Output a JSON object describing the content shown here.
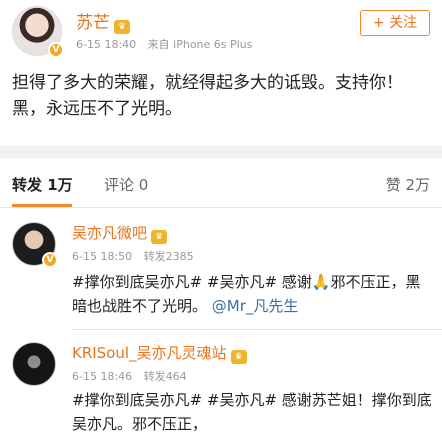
{
  "post": {
    "author": "苏芒",
    "date": "6-15 18:40",
    "source": "来自 iPhone 6s Plus",
    "follow_label": "+ 关注",
    "text": "担得了多大的荣耀，就经得起多大的诋毁。支持你！黑，永远压不了光明。"
  },
  "tabs": {
    "repost": "转发 1万",
    "comment": "评论 0",
    "like": "赞 2万"
  },
  "reposts": [
    {
      "name": "吴亦凡微吧",
      "date": "6-15 18:50",
      "count": "转发2385",
      "text_part1": "#撑你到底吴亦凡# #吴亦凡# 感谢🙏邪不压正，黑暗也战胜不了光明。",
      "mention": "@Mr_凡先生"
    },
    {
      "name": "KRISoul_吴亦凡灵魂站",
      "date": "6-15 18:46",
      "count": "转发464",
      "text": "#撑你到底吴亦凡# #吴亦凡# 感谢苏芒姐！撑你到底吴亦凡。邪不压正，"
    }
  ]
}
